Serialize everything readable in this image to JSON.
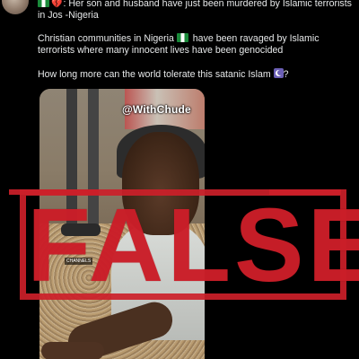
{
  "post": {
    "avatar_icon": "avatar",
    "line1": ": Her son and husband have just been murdered by Islamic terrorists in Jos -Nigeria",
    "line2_before": "Christian communities in Nigeria ",
    "line2_after": " have been ravaged by Islamic terrorists where many innocent lives have been genocided",
    "line3": "How long more can the world tolerate this satanic Islam ",
    "flag_icon": "nigeria-flag-icon",
    "heart_icon": "broken-heart-icon",
    "crescent_icon": "star-and-crescent-icon"
  },
  "video": {
    "watermark": "@WithChude",
    "small_logo": "CHANNELS"
  },
  "stamp": {
    "label": "FALSE",
    "color": "#cc1f29"
  }
}
